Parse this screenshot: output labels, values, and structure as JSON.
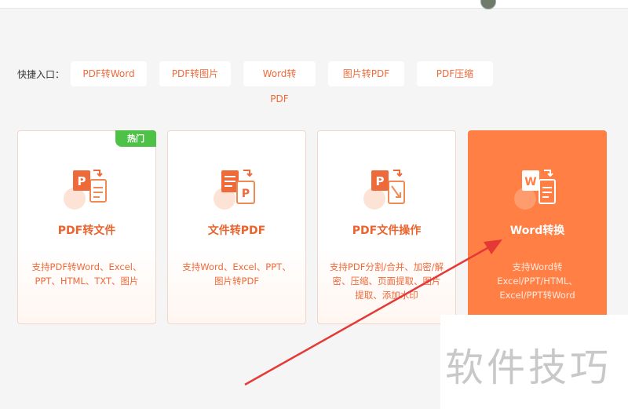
{
  "quick_entry": {
    "label": "快捷入口：",
    "items": [
      "PDF转Word",
      "PDF转图片",
      "Word转PDF",
      "图片转PDF",
      "PDF压缩"
    ]
  },
  "cards": [
    {
      "title": "PDF转文件",
      "desc": "支持PDF转Word、Excel、PPT、HTML、TXT、图片",
      "badge": "热门",
      "icon": "pdf-to-file-icon",
      "icon_letter": "P"
    },
    {
      "title": "文件转PDF",
      "desc": "支持Word、Excel、PPT、图片转PDF",
      "icon": "file-to-pdf-icon",
      "icon_letter": "P"
    },
    {
      "title": "PDF文件操作",
      "desc": "支持PDF分割/合并、加密/解密、压缩、页面提取、图片提取、添加水印",
      "icon": "pdf-operations-icon",
      "icon_letter": "P"
    },
    {
      "title": "Word转换",
      "desc": "支持Word转Excel/PPT/HTML、Excel/PPT转Word",
      "icon": "word-convert-icon",
      "icon_letter": "W"
    }
  ],
  "watermark": "软件技巧",
  "colors": {
    "accent": "#ef6a3a",
    "active_card": "#ff7f45",
    "hot_badge": "#4dc246",
    "arrow": "#e53935"
  }
}
